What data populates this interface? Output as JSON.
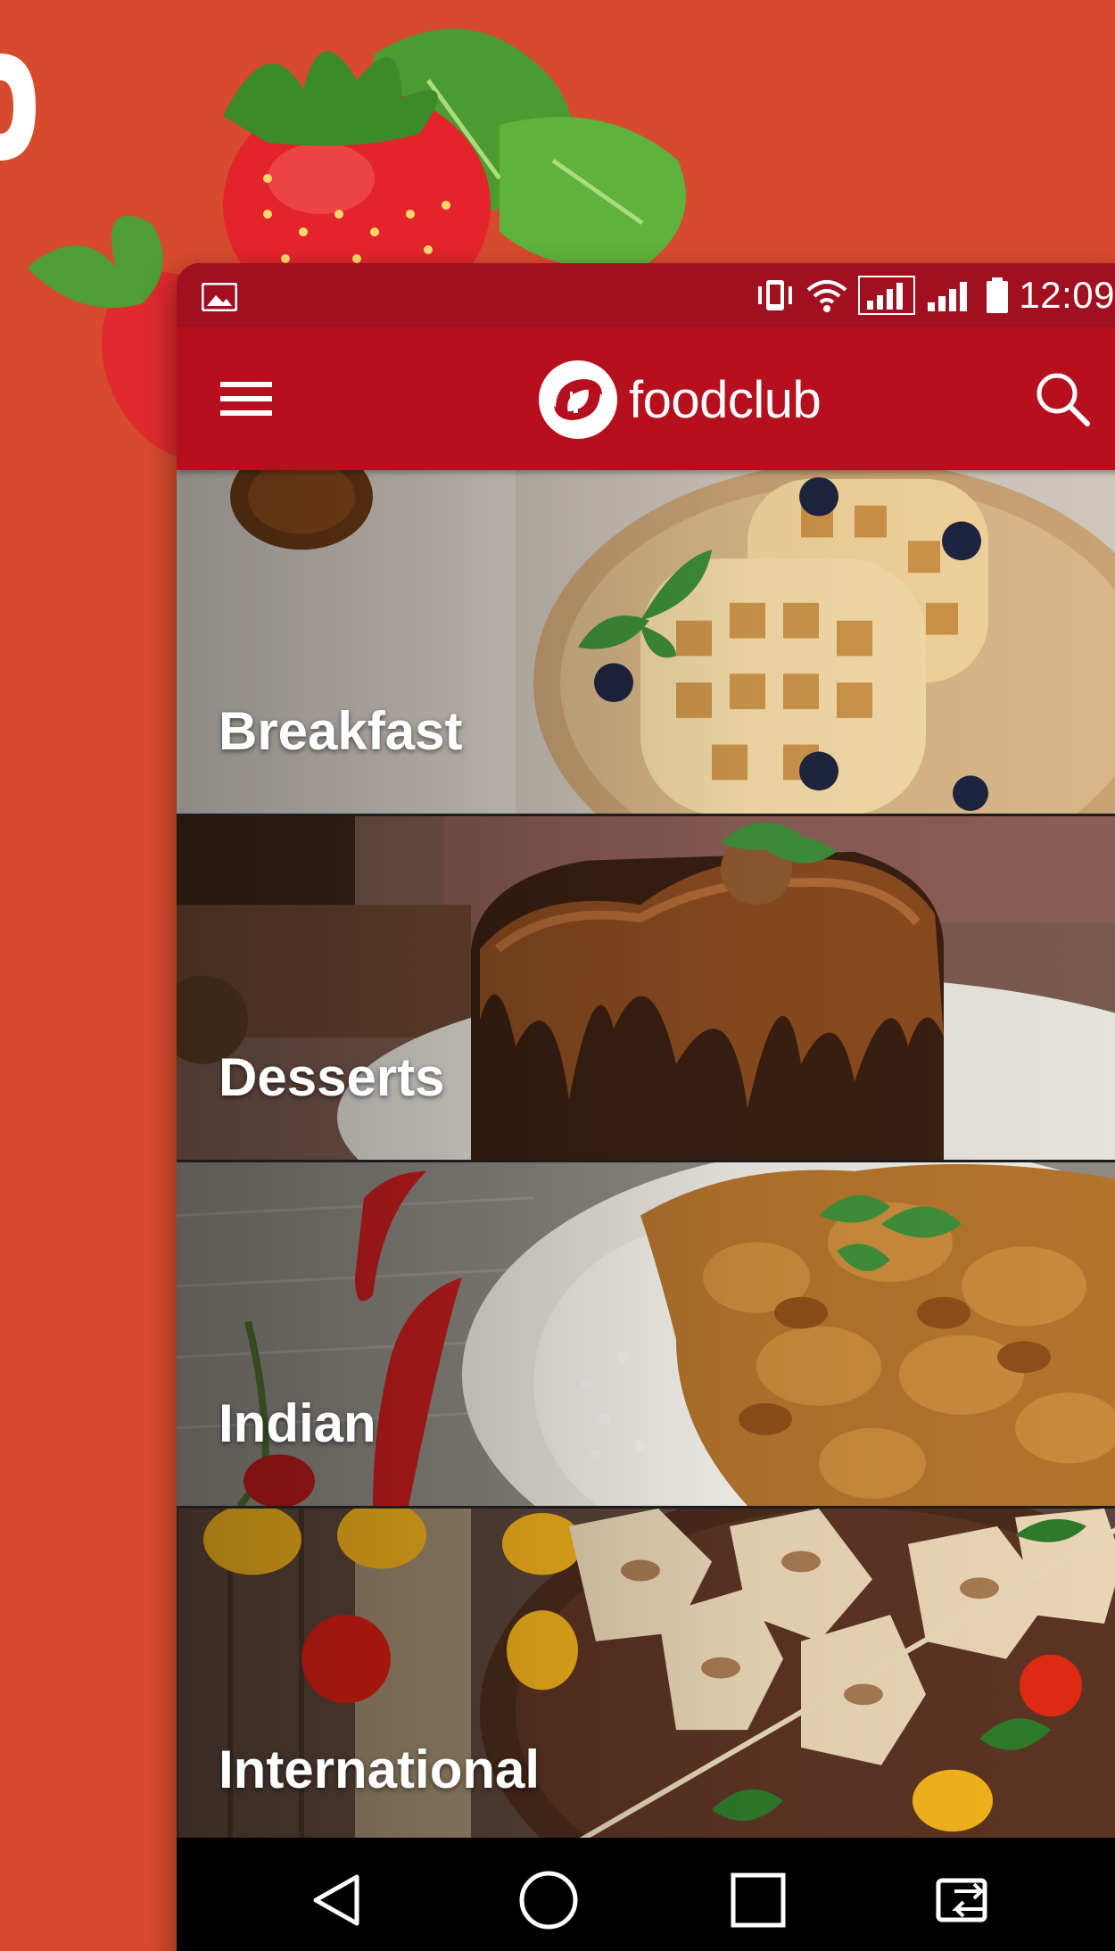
{
  "status_bar": {
    "time": "12:09",
    "icons": [
      "image-notification-icon",
      "vibrate-icon",
      "wifi-icon",
      "signal-icon",
      "signal-icon",
      "battery-icon"
    ]
  },
  "app_bar": {
    "logo_text": "foodclub",
    "menu_icon": "hamburger-menu-icon",
    "search_icon": "search-icon"
  },
  "categories": [
    {
      "label": "Breakfast"
    },
    {
      "label": "Desserts"
    },
    {
      "label": "Indian"
    },
    {
      "label": "International"
    }
  ],
  "nav_bar": {
    "buttons": [
      "back-icon",
      "home-icon",
      "recents-icon",
      "switch-sim-icon"
    ]
  },
  "colors": {
    "background": "#d84a2e",
    "app_bar": "#b6101f",
    "status_bar": "#a01020"
  }
}
